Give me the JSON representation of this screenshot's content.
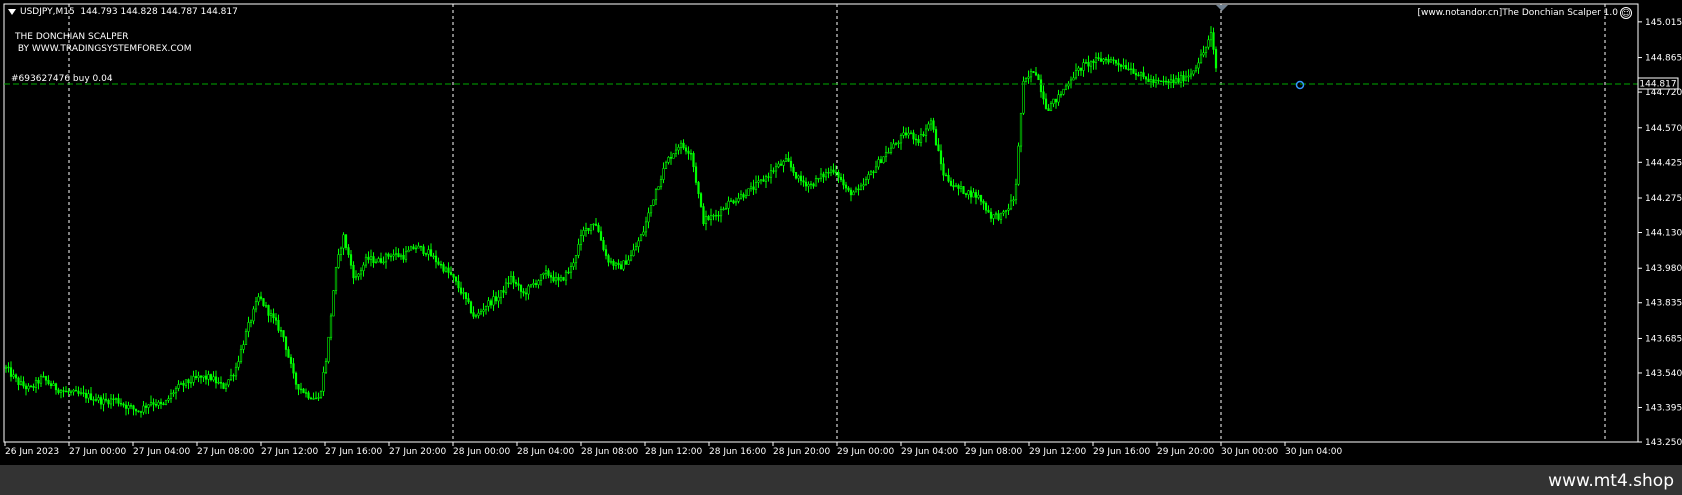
{
  "header": {
    "symbol_info": "USDJPY,M15  144.793 144.828 144.787 144.817",
    "ea_name": "[www.notandor.cn]The Donchian Scalper 1.0",
    "smiley": "☺"
  },
  "indicator": {
    "line1": "THE DONCHIAN SCALPER",
    "line2": " BY WWW.TRADINGSYSTEMFOREX.COM"
  },
  "order_label": "#693627476 buy 0.04",
  "current_price": "144.817",
  "price_levels": [
    "145.015",
    "144.865",
    "144.720",
    "144.570",
    "144.425",
    "144.275",
    "144.130",
    "143.980",
    "143.835",
    "143.685",
    "143.540",
    "143.395",
    "143.250"
  ],
  "time_labels": [
    "26 Jun 2023",
    "27 Jun 00:00",
    "27 Jun 04:00",
    "27 Jun 08:00",
    "27 Jun 12:00",
    "27 Jun 16:00",
    "27 Jun 20:00",
    "28 Jun 00:00",
    "28 Jun 04:00",
    "28 Jun 08:00",
    "28 Jun 12:00",
    "28 Jun 16:00",
    "28 Jun 20:00",
    "29 Jun 00:00",
    "29 Jun 04:00",
    "29 Jun 08:00",
    "29 Jun 12:00",
    "29 Jun 16:00",
    "29 Jun 20:00",
    "30 Jun 00:00",
    "30 Jun 04:00"
  ],
  "watermark": "www.mt4.shop",
  "colors": {
    "background": "#000000",
    "candle": "#00ff00",
    "grid": "#ffffff",
    "order_line": "#00aa00"
  },
  "chart_data": {
    "type": "candlestick",
    "ylim": [
      143.25,
      145.09
    ],
    "price_path": [
      [
        0,
        143.56
      ],
      [
        12,
        143.5
      ],
      [
        24,
        143.47
      ],
      [
        36,
        143.52
      ],
      [
        48,
        143.48
      ],
      [
        60,
        143.46
      ],
      [
        72,
        143.45
      ],
      [
        85,
        143.44
      ],
      [
        97,
        143.42
      ],
      [
        109,
        143.43
      ],
      [
        121,
        143.4
      ],
      [
        133,
        143.38
      ],
      [
        145,
        143.42
      ],
      [
        157,
        143.4
      ],
      [
        169,
        143.47
      ],
      [
        181,
        143.5
      ],
      [
        193,
        143.52
      ],
      [
        205,
        143.52
      ],
      [
        217,
        143.48
      ],
      [
        229,
        143.55
      ],
      [
        241,
        143.72
      ],
      [
        253,
        143.86
      ],
      [
        265,
        143.78
      ],
      [
        277,
        143.7
      ],
      [
        289,
        143.5
      ],
      [
        301,
        143.45
      ],
      [
        313,
        143.43
      ],
      [
        321,
        143.62
      ],
      [
        329,
        143.95
      ],
      [
        337,
        144.12
      ],
      [
        349,
        143.93
      ],
      [
        361,
        144.02
      ],
      [
        373,
        144.01
      ],
      [
        385,
        144.04
      ],
      [
        397,
        144.03
      ],
      [
        409,
        144.07
      ],
      [
        421,
        144.05
      ],
      [
        433,
        144.0
      ],
      [
        445,
        143.95
      ],
      [
        457,
        143.87
      ],
      [
        469,
        143.77
      ],
      [
        481,
        143.83
      ],
      [
        493,
        143.86
      ],
      [
        505,
        143.94
      ],
      [
        517,
        143.87
      ],
      [
        529,
        143.92
      ],
      [
        541,
        143.96
      ],
      [
        553,
        143.92
      ],
      [
        565,
        143.98
      ],
      [
        577,
        144.13
      ],
      [
        589,
        144.18
      ],
      [
        601,
        144.02
      ],
      [
        613,
        143.98
      ],
      [
        625,
        144.03
      ],
      [
        637,
        144.13
      ],
      [
        649,
        144.3
      ],
      [
        661,
        144.43
      ],
      [
        673,
        144.5
      ],
      [
        685,
        144.47
      ],
      [
        697,
        144.18
      ],
      [
        709,
        144.2
      ],
      [
        721,
        144.25
      ],
      [
        733,
        144.28
      ],
      [
        745,
        144.31
      ],
      [
        757,
        144.35
      ],
      [
        769,
        144.4
      ],
      [
        781,
        144.43
      ],
      [
        793,
        144.35
      ],
      [
        805,
        144.33
      ],
      [
        817,
        144.37
      ],
      [
        829,
        144.4
      ],
      [
        841,
        144.3
      ],
      [
        853,
        144.3
      ],
      [
        865,
        144.38
      ],
      [
        877,
        144.45
      ],
      [
        889,
        144.5
      ],
      [
        901,
        144.55
      ],
      [
        913,
        144.52
      ],
      [
        925,
        144.6
      ],
      [
        937,
        144.38
      ],
      [
        949,
        144.32
      ],
      [
        961,
        144.3
      ],
      [
        973,
        144.28
      ],
      [
        985,
        144.2
      ],
      [
        997,
        144.2
      ],
      [
        1009,
        144.28
      ],
      [
        1017,
        144.75
      ],
      [
        1029,
        144.82
      ],
      [
        1041,
        144.65
      ],
      [
        1053,
        144.7
      ],
      [
        1065,
        144.78
      ],
      [
        1077,
        144.83
      ],
      [
        1089,
        144.85
      ],
      [
        1101,
        144.86
      ],
      [
        1113,
        144.84
      ],
      [
        1125,
        144.82
      ],
      [
        1137,
        144.78
      ],
      [
        1149,
        144.76
      ],
      [
        1161,
        144.76
      ],
      [
        1173,
        144.77
      ],
      [
        1185,
        144.8
      ],
      [
        1197,
        144.88
      ],
      [
        1205,
        144.96
      ],
      [
        1210,
        144.82
      ]
    ]
  }
}
